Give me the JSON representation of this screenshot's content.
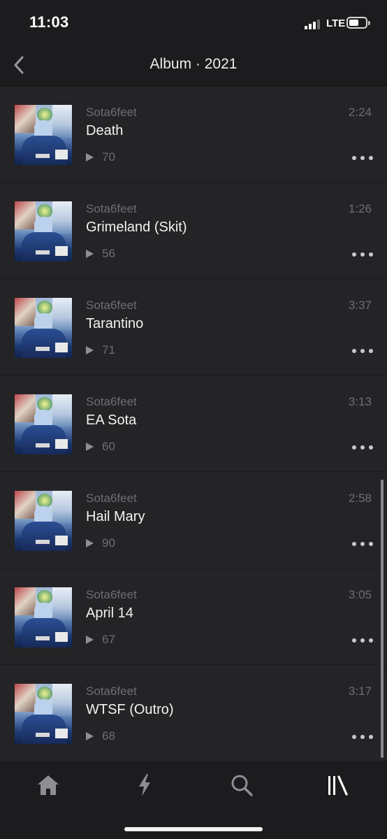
{
  "status_bar": {
    "time": "11:03",
    "network": "LTE",
    "battery_icon": "battery-icon",
    "signal_icon": "signal-icon"
  },
  "header": {
    "title": "Album · 2021",
    "back_icon": "chevron-left-icon"
  },
  "tracks": [
    {
      "artist": "Sota6feet",
      "title": "Death",
      "plays": "70",
      "duration": "2:24"
    },
    {
      "artist": "Sota6feet",
      "title": "Grimeland (Skit)",
      "plays": "56",
      "duration": "1:26"
    },
    {
      "artist": "Sota6feet",
      "title": "Tarantino",
      "plays": "71",
      "duration": "3:37"
    },
    {
      "artist": "Sota6feet",
      "title": "EA Sota",
      "plays": "60",
      "duration": "3:13"
    },
    {
      "artist": "Sota6feet",
      "title": "Hail Mary",
      "plays": "90",
      "duration": "2:58"
    },
    {
      "artist": "Sota6feet",
      "title": "April 14",
      "plays": "67",
      "duration": "3:05"
    },
    {
      "artist": "Sota6feet",
      "title": "WTSF (Outro)",
      "plays": "68",
      "duration": "3:17"
    }
  ],
  "tab_bar": {
    "tabs": [
      {
        "icon": "home-icon",
        "active": false
      },
      {
        "icon": "lightning-icon",
        "active": false
      },
      {
        "icon": "search-icon",
        "active": false
      },
      {
        "icon": "library-icon",
        "active": true
      }
    ]
  },
  "colors": {
    "background": "#242427",
    "bar": "#1c1c1e",
    "secondary_text": "#6e6e73",
    "primary_text": "#f2f2f2",
    "active_tab": "#ffffff",
    "inactive_tab": "#8e8e93"
  }
}
